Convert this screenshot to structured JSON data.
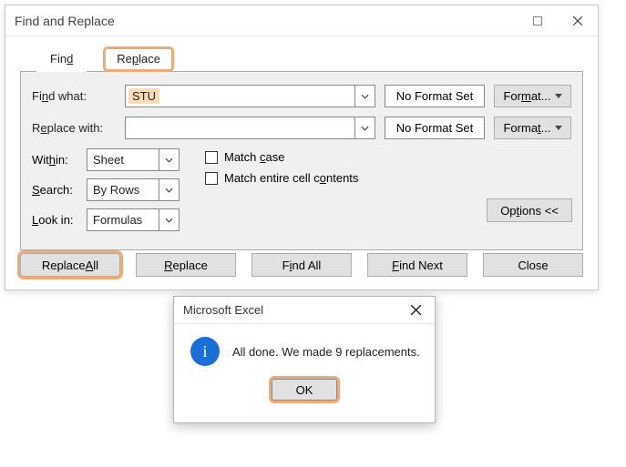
{
  "dialog": {
    "title": "Find and Replace",
    "tabs": {
      "find": "Find",
      "replace": "Replace"
    },
    "find_what_label": "Find what:",
    "find_what_value": "STU",
    "replace_with_label": "Replace with:",
    "replace_with_value": "",
    "no_format": "No Format Set",
    "format_btn": "Format...",
    "within_label": "Within:",
    "within_value": "Sheet",
    "search_label": "Search:",
    "search_value": "By Rows",
    "lookin_label": "Look in:",
    "lookin_value": "Formulas",
    "match_case": "Match case",
    "match_entire": "Match entire cell contents",
    "options_btn": "Options <<",
    "buttons": {
      "replace_all": "Replace All",
      "replace": "Replace",
      "find_all": "Find All",
      "find_next": "Find Next",
      "close": "Close"
    }
  },
  "msgbox": {
    "title": "Microsoft Excel",
    "message": "All done. We made 9 replacements.",
    "ok": "OK"
  }
}
